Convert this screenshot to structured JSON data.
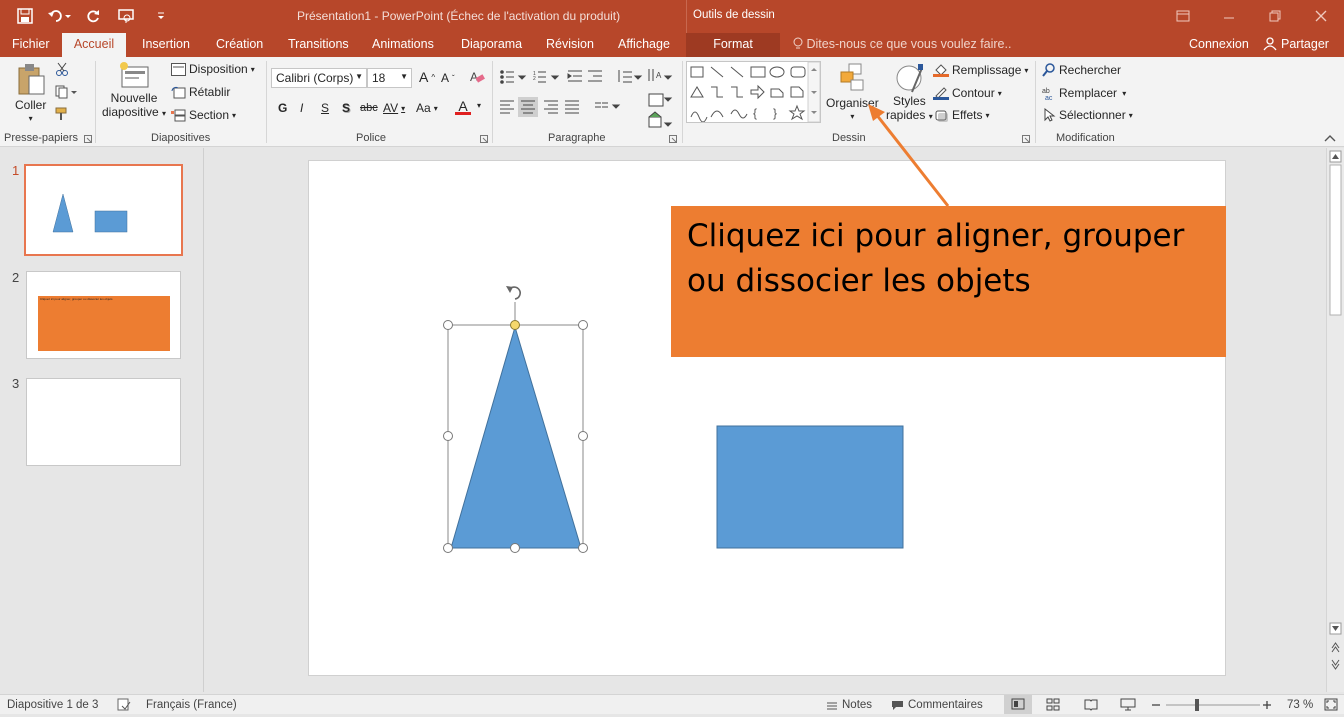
{
  "titlebar": {
    "window_title": "Présentation1 - PowerPoint (Échec de l'activation du produit)",
    "contextual_tab_group": "Outils de dessin"
  },
  "tabs": {
    "file": "Fichier",
    "items": [
      "Accueil",
      "Insertion",
      "Création",
      "Transitions",
      "Animations",
      "Diaporama",
      "Révision",
      "Affichage"
    ],
    "format": "Format",
    "tell_me": "Dites-nous ce que vous voulez faire..",
    "signin": "Connexion",
    "share": "Partager"
  },
  "ribbon": {
    "clipboard": {
      "paste": "Coller",
      "label": "Presse-papiers"
    },
    "slides": {
      "new_slide_1": "Nouvelle",
      "new_slide_2": "diapositive",
      "layout": "Disposition",
      "reset": "Rétablir",
      "section": "Section",
      "label": "Diapositives"
    },
    "font": {
      "font_name": "Calibri (Corps)",
      "font_size": "18",
      "bold": "G",
      "italic": "I",
      "underline": "S",
      "shadow": "S",
      "strike": "abc",
      "spacing": "AV",
      "case": "Aa",
      "color": "A",
      "label": "Police"
    },
    "paragraph": {
      "label": "Paragraphe"
    },
    "drawing": {
      "arrange": "Organiser",
      "styles_1": "Styles",
      "styles_2": "rapides",
      "fill": "Remplissage",
      "outline": "Contour",
      "effects": "Effets",
      "label": "Dessin"
    },
    "editing": {
      "find": "Rechercher",
      "replace": "Remplacer",
      "select": "Sélectionner",
      "label": "Modification"
    }
  },
  "slides_pane": {
    "numbers": [
      "1",
      "2",
      "3"
    ],
    "slide2_text": "Cliquez ici pour aligner, grouper ou dissocier les objets"
  },
  "slide": {
    "callout_line1": "Cliquez ici pour aligner, grouper",
    "callout_line2": "ou dissocier les objets",
    "colors": {
      "shape_fill": "#5b9bd5",
      "callout": "#ed7d31",
      "accent": "#b7472a"
    }
  },
  "statusbar": {
    "slide_info": "Diapositive 1 de 3",
    "language": "Français (France)",
    "notes": "Notes",
    "comments": "Commentaires",
    "zoom": "73 %"
  }
}
